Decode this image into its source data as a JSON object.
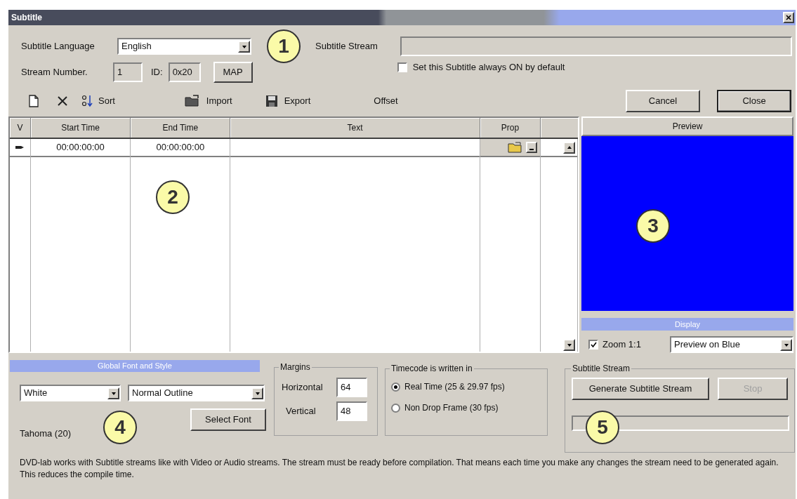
{
  "window": {
    "title": "Subtitle"
  },
  "subtitle_language": {
    "label": "Subtitle Language",
    "value": "English"
  },
  "subtitle_stream": {
    "label": "Subtitle Stream"
  },
  "stream_number": {
    "label": "Stream Number.",
    "value": "1"
  },
  "stream_id": {
    "label": "ID:",
    "value": "0x20"
  },
  "map_button": "MAP",
  "always_on": {
    "label": "Set this Subtitle always ON by default",
    "checked": false
  },
  "toolbar": [
    {
      "kind": "new"
    },
    {
      "kind": "delete"
    },
    {
      "kind": "sort",
      "label": "Sort"
    },
    {
      "kind": "import",
      "label": "Import"
    },
    {
      "kind": "export",
      "label": "Export"
    },
    {
      "kind": "text",
      "label": "Offset"
    }
  ],
  "dialog_buttons": [
    {
      "label": "Cancel",
      "default": false
    },
    {
      "label": "Close",
      "default": true
    }
  ],
  "table": {
    "columns": [
      "V",
      "Start Time",
      "End Time",
      "Text",
      "Prop"
    ],
    "rows": [
      {
        "start_time": "00:00:00:00",
        "end_time": "00:00:00:00"
      }
    ]
  },
  "preview": {
    "title": "Preview",
    "display_title": "Display",
    "zoom": {
      "label": "Zoom 1:1",
      "checked": true
    },
    "mode": "Preview on Blue"
  },
  "font_style": {
    "title": "Global Font and Style",
    "text_fill": "White",
    "style": "Normal Outline",
    "button": "Select Font",
    "font": "Tahoma (20)"
  },
  "margins": {
    "title": "Margins",
    "horizontal": {
      "label": "Horizontal",
      "value": "64"
    },
    "vertical": {
      "label": "Vertical",
      "value": "48"
    }
  },
  "timecode": {
    "title": "Timecode is written in",
    "options": [
      {
        "label": "Real Time (25 & 29.97 fps)",
        "selected": true
      },
      {
        "label": "Non Drop Frame (30 fps)",
        "selected": false
      }
    ]
  },
  "stream_generation": {
    "title": "Subtitle Stream",
    "generate_button": "Generate Subtitle Stream",
    "stop_button": {
      "label": "Stop",
      "disabled": true
    },
    "level": 0
  },
  "note": "DVD-lab works with Subtitle streams like with Video or Audio streams. The stream must be ready before compilation. That means each time you make any changes the stream need to be generated again. This reduces the compile time.",
  "callouts": [
    "1",
    "2",
    "3",
    "4",
    "5"
  ]
}
